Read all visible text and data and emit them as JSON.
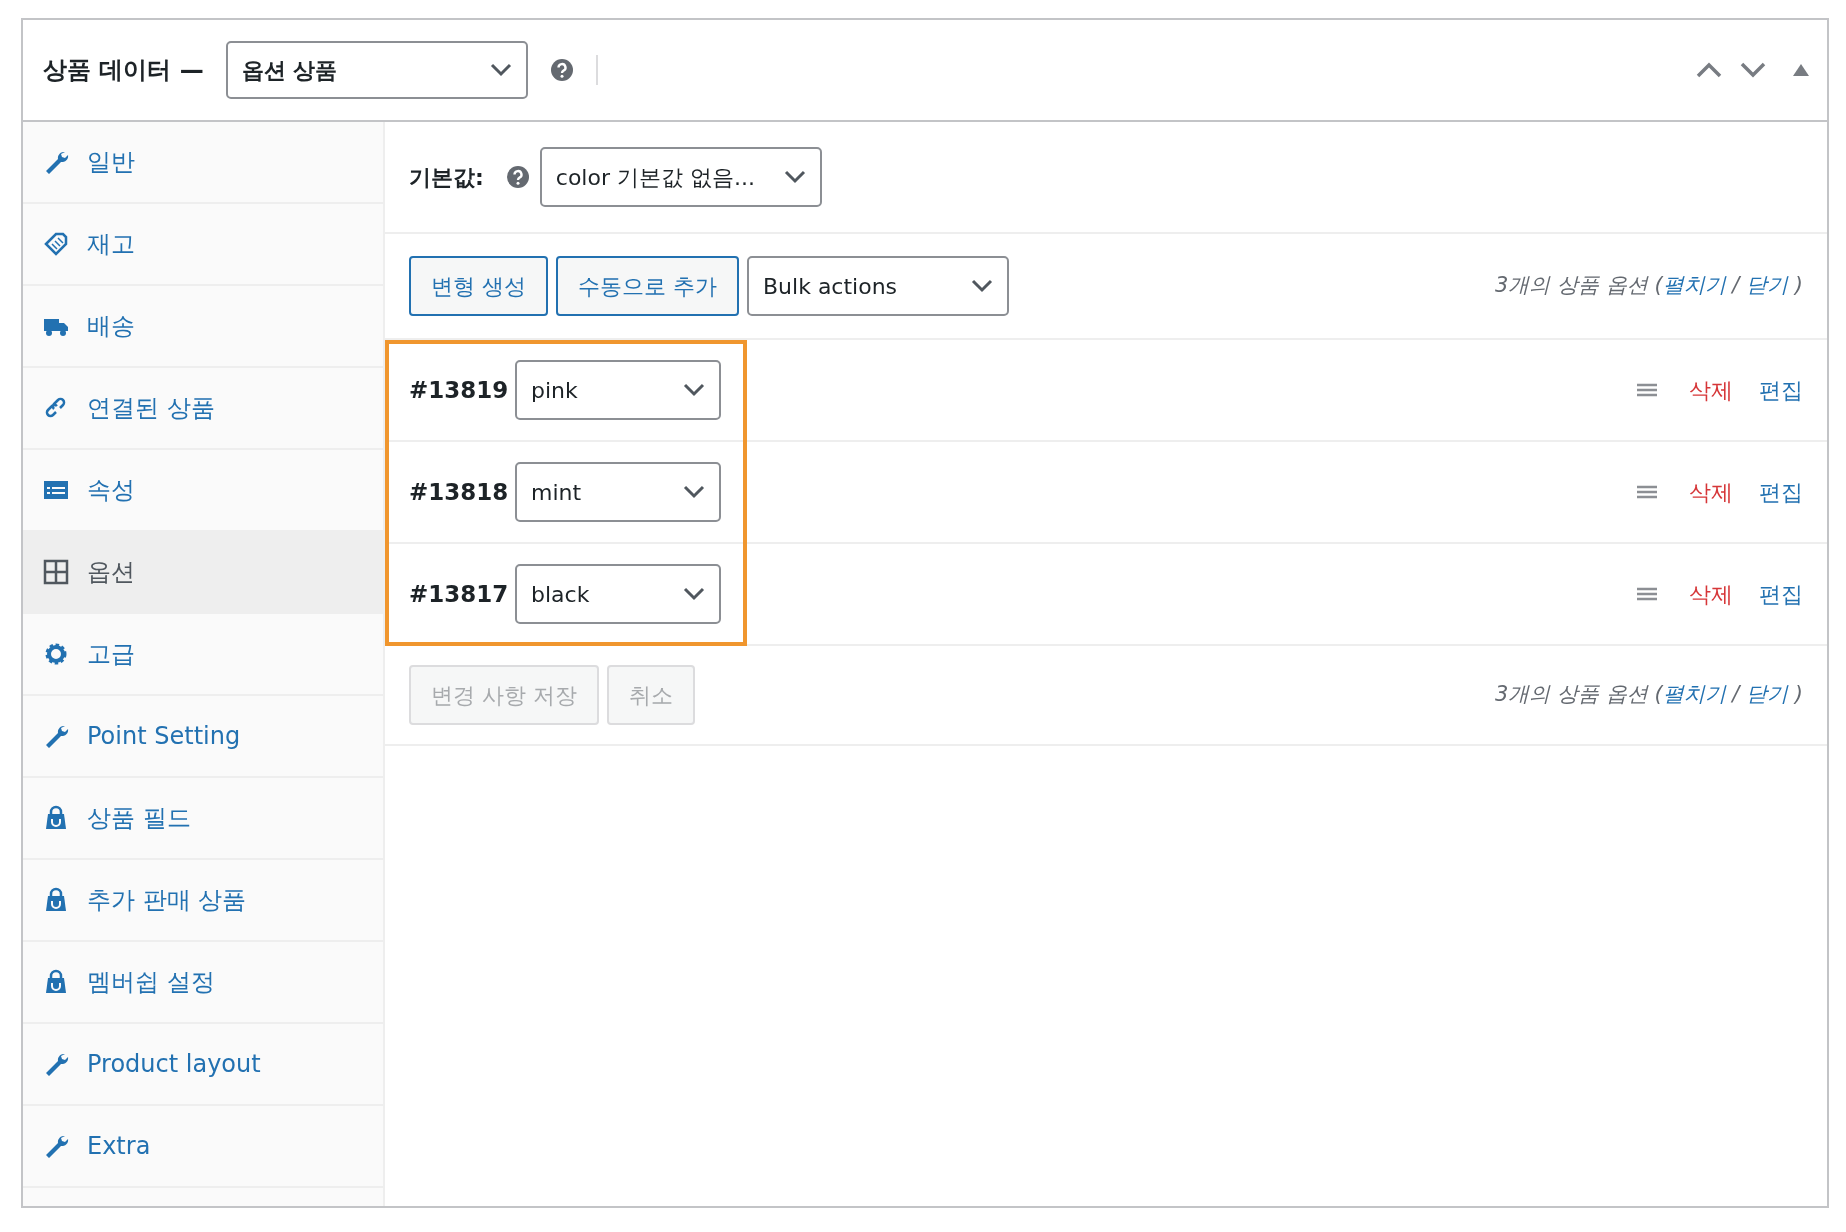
{
  "panel": {
    "title": "상품 데이터 —",
    "product_type": "옵션 상품"
  },
  "sidebar": {
    "items": [
      {
        "label": "일반",
        "selected": false
      },
      {
        "label": "재고",
        "selected": false
      },
      {
        "label": "배송",
        "selected": false
      },
      {
        "label": "연결된 상품",
        "selected": false
      },
      {
        "label": "속성",
        "selected": false
      },
      {
        "label": "옵션",
        "selected": true
      },
      {
        "label": "고급",
        "selected": false
      },
      {
        "label": "Point Setting",
        "selected": false
      },
      {
        "label": "상품 필드",
        "selected": false
      },
      {
        "label": "추가 판매 상품",
        "selected": false
      },
      {
        "label": "멤버쉽 설정",
        "selected": false
      },
      {
        "label": "Product layout",
        "selected": false
      },
      {
        "label": "Extra",
        "selected": false
      }
    ]
  },
  "defaults": {
    "label": "기본값:",
    "value": "color 기본값 없음..."
  },
  "toolbar": {
    "buttons": [
      {
        "label": "변형 생성"
      },
      {
        "label": "수동으로 추가"
      }
    ],
    "bulk_actions": "Bulk actions",
    "summary": {
      "prefix": "3개의 상품 옵션 (",
      "expand": "펼치기",
      "separator": " / ",
      "collapse": "닫기",
      "suffix": " )"
    }
  },
  "variations": [
    {
      "id": "#13819",
      "value": "pink",
      "delete": "삭제",
      "edit": "편집"
    },
    {
      "id": "#13818",
      "value": "mint",
      "delete": "삭제",
      "edit": "편집"
    },
    {
      "id": "#13817",
      "value": "black",
      "delete": "삭제",
      "edit": "편집"
    }
  ],
  "footer": {
    "buttons": [
      {
        "label": "변경 사항 저장",
        "disabled": true
      },
      {
        "label": "취소",
        "disabled": true
      }
    ],
    "summary": {
      "prefix": "3개의 상품 옵션 (",
      "expand": "펼치기",
      "separator": " / ",
      "collapse": "닫기",
      "suffix": " )"
    }
  }
}
